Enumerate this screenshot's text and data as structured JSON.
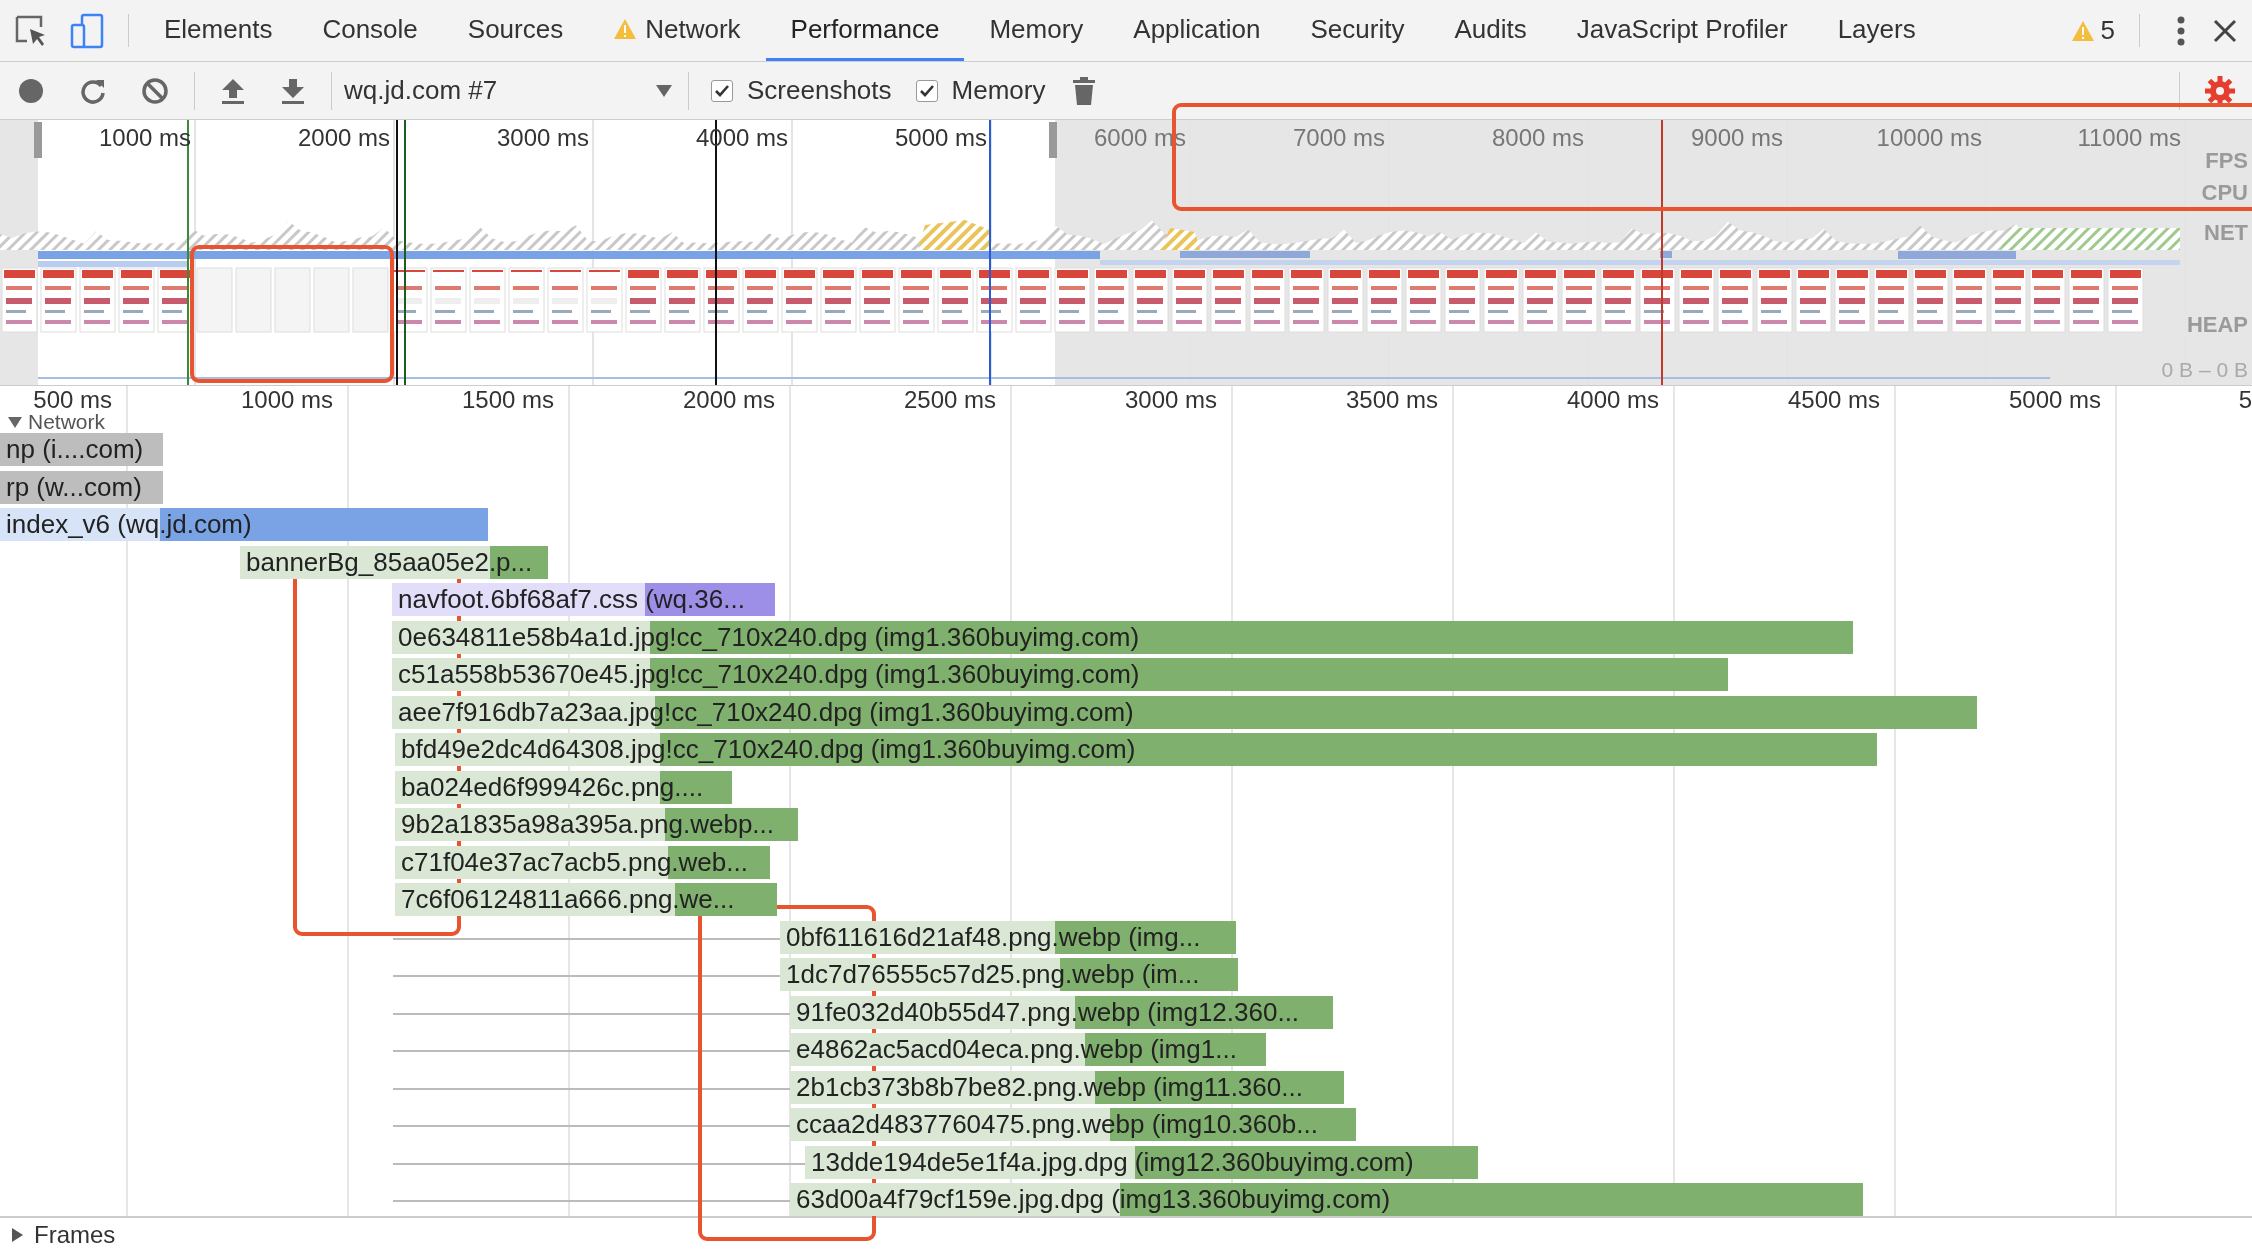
{
  "devtools_tabs": [
    {
      "label": "Elements",
      "selected": false,
      "warning": false
    },
    {
      "label": "Console",
      "selected": false,
      "warning": false
    },
    {
      "label": "Sources",
      "selected": false,
      "warning": false
    },
    {
      "label": "Network",
      "selected": false,
      "warning": true
    },
    {
      "label": "Performance",
      "selected": true,
      "warning": false
    },
    {
      "label": "Memory",
      "selected": false,
      "warning": false
    },
    {
      "label": "Application",
      "selected": false,
      "warning": false
    },
    {
      "label": "Security",
      "selected": false,
      "warning": false
    },
    {
      "label": "Audits",
      "selected": false,
      "warning": false
    },
    {
      "label": "JavaScript Profiler",
      "selected": false,
      "warning": false
    },
    {
      "label": "Layers",
      "selected": false,
      "warning": false
    }
  ],
  "warnings_count": "5",
  "toolbar": {
    "profile_select": "wq.jd.com #7",
    "checkboxes": [
      {
        "label": "Screenshots",
        "checked": true
      },
      {
        "label": "Memory",
        "checked": true
      }
    ]
  },
  "overview": {
    "time_labels": [
      "1000 ms",
      "2000 ms",
      "3000 ms",
      "4000 ms",
      "5000 ms",
      "6000 ms",
      "7000 ms",
      "8000 ms",
      "9000 ms",
      "10000 ms",
      "11000 ms"
    ],
    "track_labels": [
      "FPS",
      "CPU",
      "NET",
      "HEAP"
    ],
    "heap_range": "0 B – 0 B"
  },
  "ruler": {
    "time_labels": [
      "500 ms",
      "1000 ms",
      "1500 ms",
      "2000 ms",
      "2500 ms",
      "3000 ms",
      "3500 ms",
      "4000 ms",
      "4500 ms",
      "5000 ms",
      "5"
    ]
  },
  "network_track": {
    "title": "Network",
    "expanded": true,
    "rows": [
      {
        "label": "np (i....com)",
        "color": "#bdbdbd"
      },
      {
        "label": "rp (w...com)",
        "color": "#bdbdbd"
      },
      {
        "label": "index_v6 (wq.jd.com)",
        "color": "#7aa3e5"
      },
      {
        "label": "bannerBg_85aa05e2.p...",
        "color": "#80b06e"
      },
      {
        "label": "navfoot.6bf68af7.css (wq.36...",
        "color": "#9d8ee8"
      },
      {
        "label": "0e634811e58b4a1d.jpg!cc_710x240.dpg (img1.360buyimg.com)",
        "color": "#80b06e"
      },
      {
        "label": "c51a558b53670e45.jpg!cc_710x240.dpg (img1.360buyimg.com)",
        "color": "#80b06e"
      },
      {
        "label": "aee7f916db7a23aa.jpg!cc_710x240.dpg (img1.360buyimg.com)",
        "color": "#80b06e"
      },
      {
        "label": "bfd49e2dc4d64308.jpg!cc_710x240.dpg (img1.360buyimg.com)",
        "color": "#80b06e"
      },
      {
        "label": "ba024ed6f999426c.png....",
        "color": "#80b06e"
      },
      {
        "label": "9b2a1835a98a395a.png.webp...",
        "color": "#80b06e"
      },
      {
        "label": "c71f04e37ac7acb5.png.web...",
        "color": "#80b06e"
      },
      {
        "label": "7c6f06124811a666.png.we...",
        "color": "#80b06e"
      },
      {
        "label": "0bf611616d21af48.png.webp (img...",
        "color": "#80b06e"
      },
      {
        "label": "1dc7d76555c57d25.png.webp (im...",
        "color": "#80b06e"
      },
      {
        "label": "91fe032d40b55d47.png.webp (img12.360...",
        "color": "#80b06e"
      },
      {
        "label": "e4862ac5acd04eca.png.webp (img1...",
        "color": "#80b06e"
      },
      {
        "label": "2b1cb373b8b7be82.png.webp (img11.360...",
        "color": "#80b06e"
      },
      {
        "label": "ccaa2d4837760475.png.webp (img10.360b...",
        "color": "#80b06e"
      },
      {
        "label": "13dde194de5e1f4a.jpg.dpg (img12.360buyimg.com)",
        "color": "#80b06e"
      },
      {
        "label": "63d00a4f79cf159e.jpg.dpg (img13.360buyimg.com)",
        "color": "#80b06e"
      }
    ]
  },
  "frames_track": {
    "title": "Frames",
    "expanded": false
  },
  "annotations": [
    {
      "kind": "overview-blank-screenshots"
    },
    {
      "kind": "overview-idle-range"
    },
    {
      "kind": "first-request-gap"
    },
    {
      "kind": "second-request-gap"
    }
  ]
}
